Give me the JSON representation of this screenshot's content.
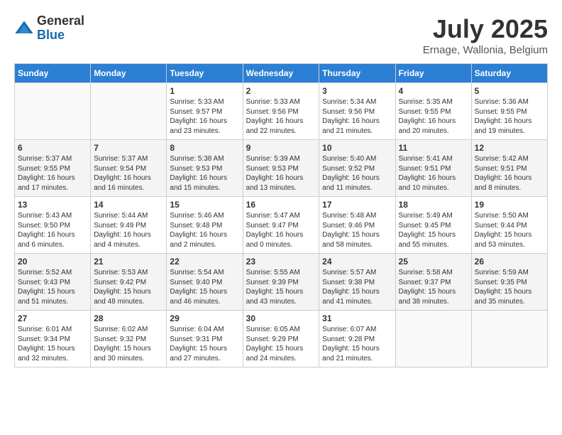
{
  "header": {
    "logo_general": "General",
    "logo_blue": "Blue",
    "month_title": "July 2025",
    "location": "Ernage, Wallonia, Belgium"
  },
  "days_of_week": [
    "Sunday",
    "Monday",
    "Tuesday",
    "Wednesday",
    "Thursday",
    "Friday",
    "Saturday"
  ],
  "weeks": [
    [
      {
        "day": "",
        "info": ""
      },
      {
        "day": "",
        "info": ""
      },
      {
        "day": "1",
        "info": "Sunrise: 5:33 AM\nSunset: 9:57 PM\nDaylight: 16 hours and 23 minutes."
      },
      {
        "day": "2",
        "info": "Sunrise: 5:33 AM\nSunset: 9:56 PM\nDaylight: 16 hours and 22 minutes."
      },
      {
        "day": "3",
        "info": "Sunrise: 5:34 AM\nSunset: 9:56 PM\nDaylight: 16 hours and 21 minutes."
      },
      {
        "day": "4",
        "info": "Sunrise: 5:35 AM\nSunset: 9:55 PM\nDaylight: 16 hours and 20 minutes."
      },
      {
        "day": "5",
        "info": "Sunrise: 5:36 AM\nSunset: 9:55 PM\nDaylight: 16 hours and 19 minutes."
      }
    ],
    [
      {
        "day": "6",
        "info": "Sunrise: 5:37 AM\nSunset: 9:55 PM\nDaylight: 16 hours and 17 minutes."
      },
      {
        "day": "7",
        "info": "Sunrise: 5:37 AM\nSunset: 9:54 PM\nDaylight: 16 hours and 16 minutes."
      },
      {
        "day": "8",
        "info": "Sunrise: 5:38 AM\nSunset: 9:53 PM\nDaylight: 16 hours and 15 minutes."
      },
      {
        "day": "9",
        "info": "Sunrise: 5:39 AM\nSunset: 9:53 PM\nDaylight: 16 hours and 13 minutes."
      },
      {
        "day": "10",
        "info": "Sunrise: 5:40 AM\nSunset: 9:52 PM\nDaylight: 16 hours and 11 minutes."
      },
      {
        "day": "11",
        "info": "Sunrise: 5:41 AM\nSunset: 9:51 PM\nDaylight: 16 hours and 10 minutes."
      },
      {
        "day": "12",
        "info": "Sunrise: 5:42 AM\nSunset: 9:51 PM\nDaylight: 16 hours and 8 minutes."
      }
    ],
    [
      {
        "day": "13",
        "info": "Sunrise: 5:43 AM\nSunset: 9:50 PM\nDaylight: 16 hours and 6 minutes."
      },
      {
        "day": "14",
        "info": "Sunrise: 5:44 AM\nSunset: 9:49 PM\nDaylight: 16 hours and 4 minutes."
      },
      {
        "day": "15",
        "info": "Sunrise: 5:46 AM\nSunset: 9:48 PM\nDaylight: 16 hours and 2 minutes."
      },
      {
        "day": "16",
        "info": "Sunrise: 5:47 AM\nSunset: 9:47 PM\nDaylight: 16 hours and 0 minutes."
      },
      {
        "day": "17",
        "info": "Sunrise: 5:48 AM\nSunset: 9:46 PM\nDaylight: 15 hours and 58 minutes."
      },
      {
        "day": "18",
        "info": "Sunrise: 5:49 AM\nSunset: 9:45 PM\nDaylight: 15 hours and 55 minutes."
      },
      {
        "day": "19",
        "info": "Sunrise: 5:50 AM\nSunset: 9:44 PM\nDaylight: 15 hours and 53 minutes."
      }
    ],
    [
      {
        "day": "20",
        "info": "Sunrise: 5:52 AM\nSunset: 9:43 PM\nDaylight: 15 hours and 51 minutes."
      },
      {
        "day": "21",
        "info": "Sunrise: 5:53 AM\nSunset: 9:42 PM\nDaylight: 15 hours and 48 minutes."
      },
      {
        "day": "22",
        "info": "Sunrise: 5:54 AM\nSunset: 9:40 PM\nDaylight: 15 hours and 46 minutes."
      },
      {
        "day": "23",
        "info": "Sunrise: 5:55 AM\nSunset: 9:39 PM\nDaylight: 15 hours and 43 minutes."
      },
      {
        "day": "24",
        "info": "Sunrise: 5:57 AM\nSunset: 9:38 PM\nDaylight: 15 hours and 41 minutes."
      },
      {
        "day": "25",
        "info": "Sunrise: 5:58 AM\nSunset: 9:37 PM\nDaylight: 15 hours and 38 minutes."
      },
      {
        "day": "26",
        "info": "Sunrise: 5:59 AM\nSunset: 9:35 PM\nDaylight: 15 hours and 35 minutes."
      }
    ],
    [
      {
        "day": "27",
        "info": "Sunrise: 6:01 AM\nSunset: 9:34 PM\nDaylight: 15 hours and 32 minutes."
      },
      {
        "day": "28",
        "info": "Sunrise: 6:02 AM\nSunset: 9:32 PM\nDaylight: 15 hours and 30 minutes."
      },
      {
        "day": "29",
        "info": "Sunrise: 6:04 AM\nSunset: 9:31 PM\nDaylight: 15 hours and 27 minutes."
      },
      {
        "day": "30",
        "info": "Sunrise: 6:05 AM\nSunset: 9:29 PM\nDaylight: 15 hours and 24 minutes."
      },
      {
        "day": "31",
        "info": "Sunrise: 6:07 AM\nSunset: 9:28 PM\nDaylight: 15 hours and 21 minutes."
      },
      {
        "day": "",
        "info": ""
      },
      {
        "day": "",
        "info": ""
      }
    ]
  ]
}
